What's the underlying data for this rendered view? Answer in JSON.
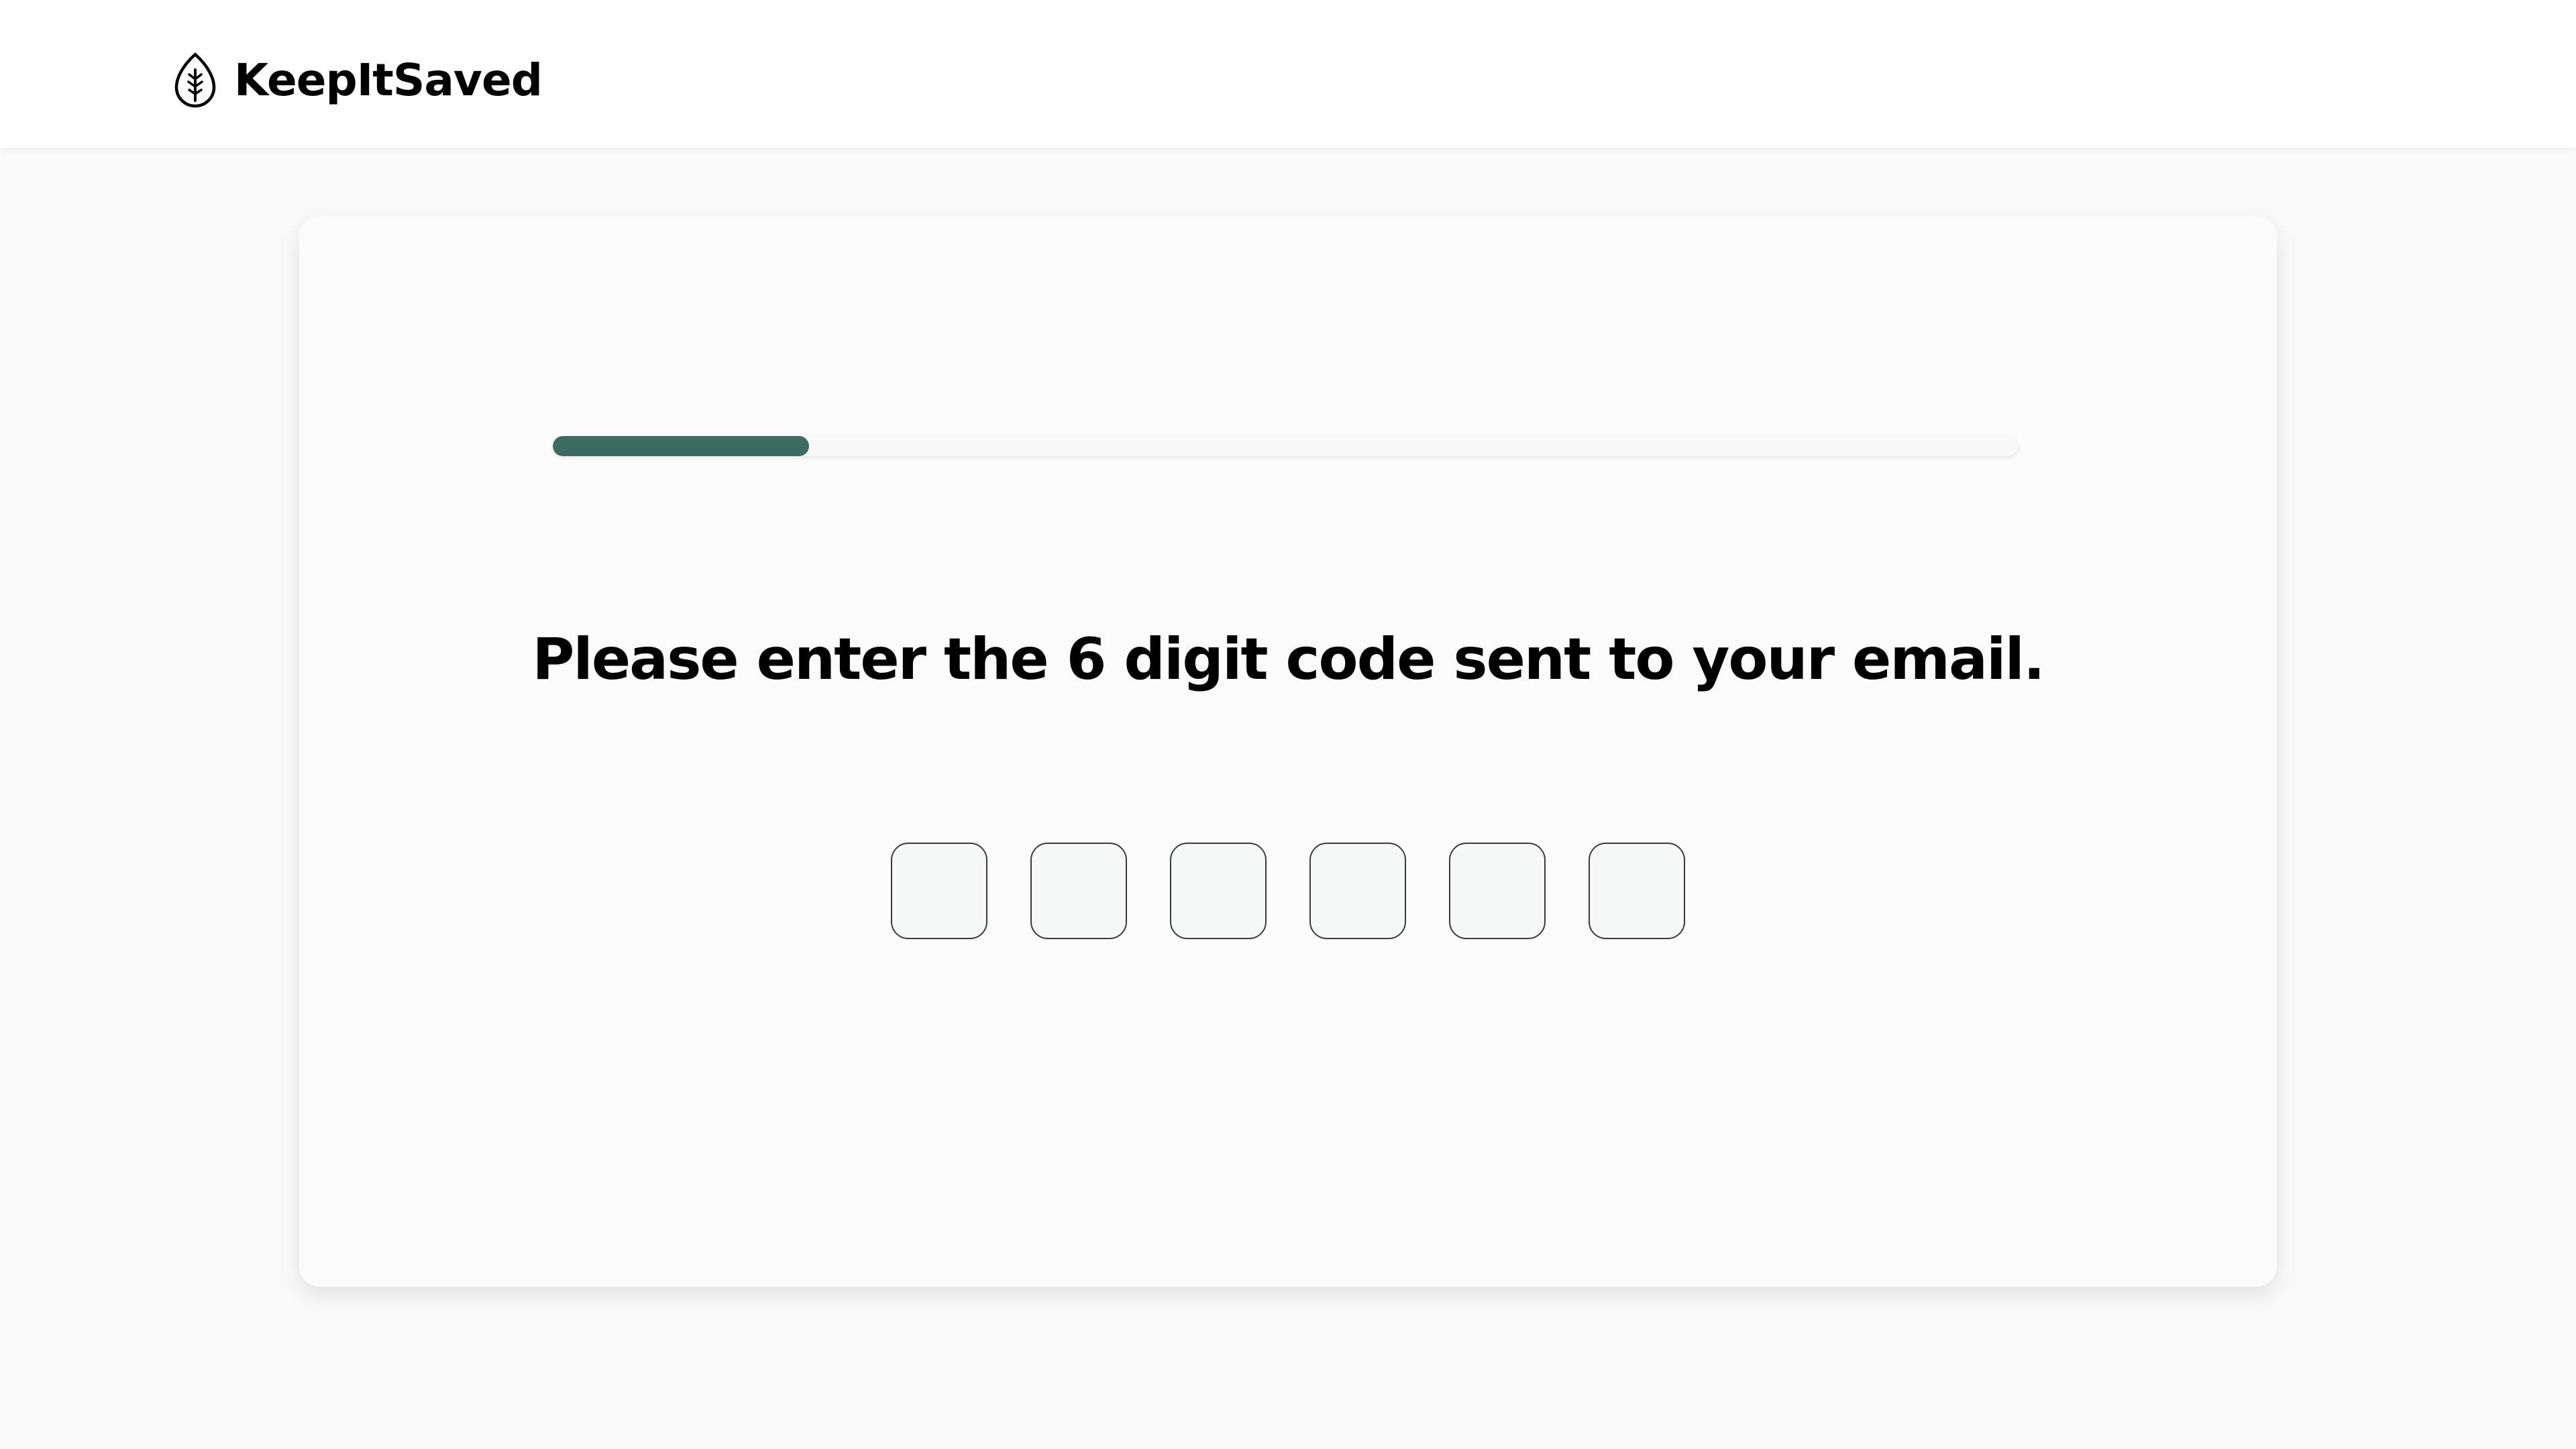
{
  "header": {
    "brand_name": "KeepItSaved",
    "logo_icon": "leaf-icon"
  },
  "verification": {
    "progress_percent": 17.5,
    "prompt": "Please enter the 6 digit code sent to your email.",
    "code_digits": [
      "",
      "",
      "",
      "",
      "",
      ""
    ]
  },
  "colors": {
    "accent": "#3d6b60",
    "background": "#fafafa",
    "card": "#fbfbfb"
  }
}
